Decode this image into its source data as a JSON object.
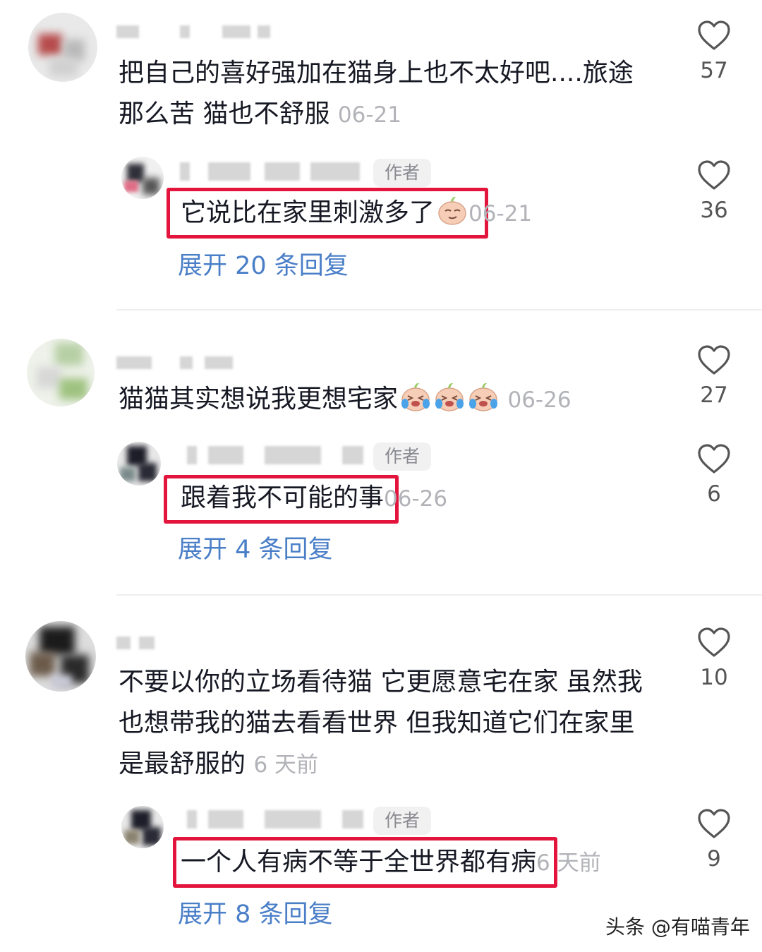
{
  "comments": [
    {
      "text_line1": "把自己的喜好强加在猫身上也不太好吧....旅途",
      "text_line2": "那么苦 猫也不舒服",
      "time": "06-21",
      "likes": "57",
      "reply": {
        "author_tag": "作者",
        "text": "它说比在家里刺激多了",
        "time": "06-21",
        "likes": "36"
      },
      "expand": "展开 20 条回复"
    },
    {
      "text_line1": "猫猫其实想说我更想宅家",
      "time": "06-26",
      "likes": "27",
      "reply": {
        "author_tag": "作者",
        "text": "跟着我不可能的事",
        "time": "06-26",
        "likes": "6"
      },
      "expand": "展开 4 条回复"
    },
    {
      "text_line1": "不要以你的立场看待猫 它更愿意宅在家 虽然我",
      "text_line2": "也想带我的猫去看看世界 但我知道它们在家里",
      "text_line3": "是最舒服的",
      "time": "6 天前",
      "likes": "10",
      "reply": {
        "author_tag": "作者",
        "text": "一个人有病不等于全世界都有病",
        "time": "6 天前",
        "likes": "9"
      },
      "expand": "展开 8 条回复"
    }
  ],
  "watermark": "头条 @有喵青年",
  "colors": {
    "highlight_border": "#e3153d",
    "expand_link": "#4a7fc8",
    "timestamp": "#b2b3b8"
  },
  "icons": {
    "like": "heart-outline-icon",
    "emoji": "smirk-emoji-icon",
    "emoji_cry": "laugh-cry-emoji-icon"
  }
}
